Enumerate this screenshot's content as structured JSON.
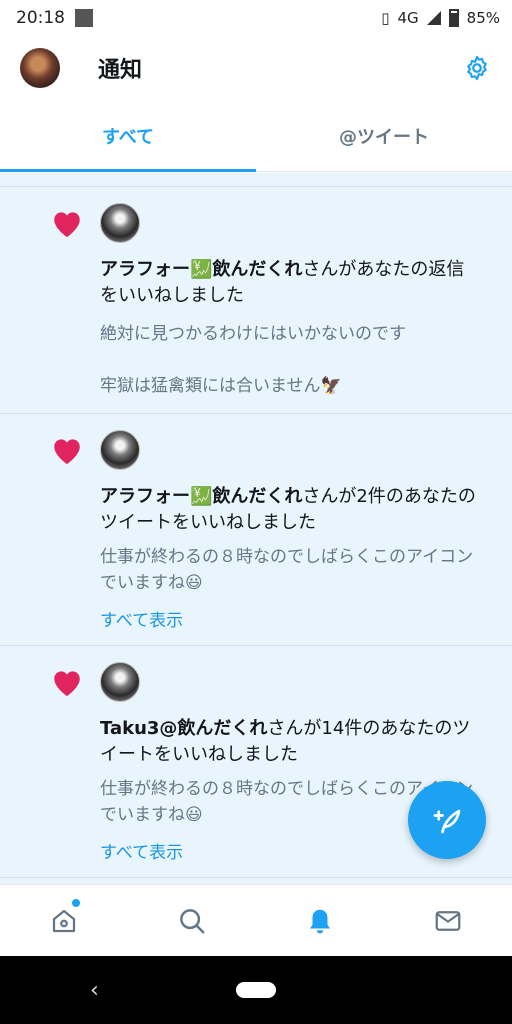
{
  "status": {
    "time": "20:18",
    "network": "4G",
    "battery": "85%"
  },
  "header": {
    "title": "通知"
  },
  "tabs": [
    {
      "label": "すべて"
    },
    {
      "label": "@ツイート"
    }
  ],
  "notifications": [
    {
      "user": "アラフォー💹飲んだくれ",
      "action": "さんがあなたの返信をいいねしました",
      "preview": "絶対に見つかるわけにはいかないのです\n\n牢獄は猛禽類には合いません🦅"
    },
    {
      "user": "アラフォー💹飲んだくれ",
      "action": "さんが2件のあなたのツイートをいいねしました",
      "preview": "仕事が終わるの８時なのでしばらくこのアイコンでいますね😃",
      "show_all": "すべて表示"
    },
    {
      "user": "Taku3@飲んだくれ",
      "action": "さんが14件のあなたのツイートをいいねしました",
      "preview": "仕事が終わるの８時なのでしばらくこのアイコンでいますね😃",
      "show_all": "すべて表示"
    }
  ],
  "nav": [
    "home-icon",
    "search-icon",
    "notifications-icon",
    "messages-icon"
  ],
  "colors": {
    "accent": "#1da1f2",
    "heart": "#e0245e",
    "feed_bg": "#e8f5fd"
  }
}
